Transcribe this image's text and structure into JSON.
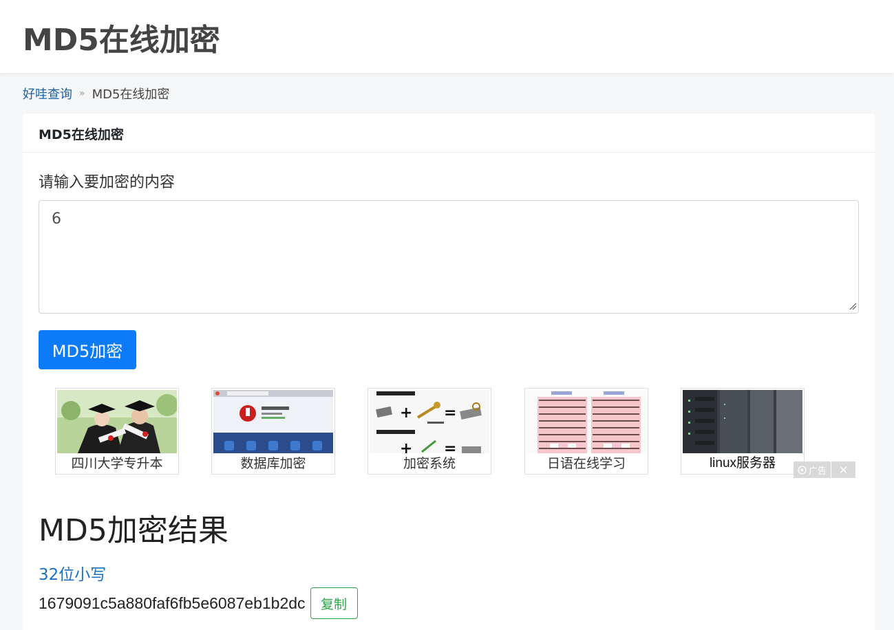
{
  "header": {
    "title": "MD5在线加密"
  },
  "breadcrumb": {
    "home": "好哇查询",
    "separator": "»",
    "current": "MD5在线加密"
  },
  "card": {
    "title": "MD5在线加密",
    "input_label": "请输入要加密的内容",
    "input_value": "6",
    "submit_label": "MD5加密"
  },
  "ads": {
    "items": [
      {
        "caption": "四川大学专升本",
        "icon": "graduates-photo"
      },
      {
        "caption": "数据库加密",
        "icon": "app-screenshot"
      },
      {
        "caption": "加密系统",
        "icon": "encryption-diagram"
      },
      {
        "caption": "日语在线学习",
        "icon": "kana-chart"
      },
      {
        "caption": "linux服务器",
        "icon": "server-rack-photo"
      }
    ],
    "ad_label": "广告",
    "close_symbol": "✕"
  },
  "result": {
    "title": "MD5加密结果",
    "subhead": "32位小写",
    "hash": "1679091c5a880faf6fb5e6087eb1b2dc",
    "copy_label": "复制"
  },
  "colors": {
    "primary": "#0d7bf7",
    "link": "#1a6fc0",
    "success": "#28a745"
  }
}
